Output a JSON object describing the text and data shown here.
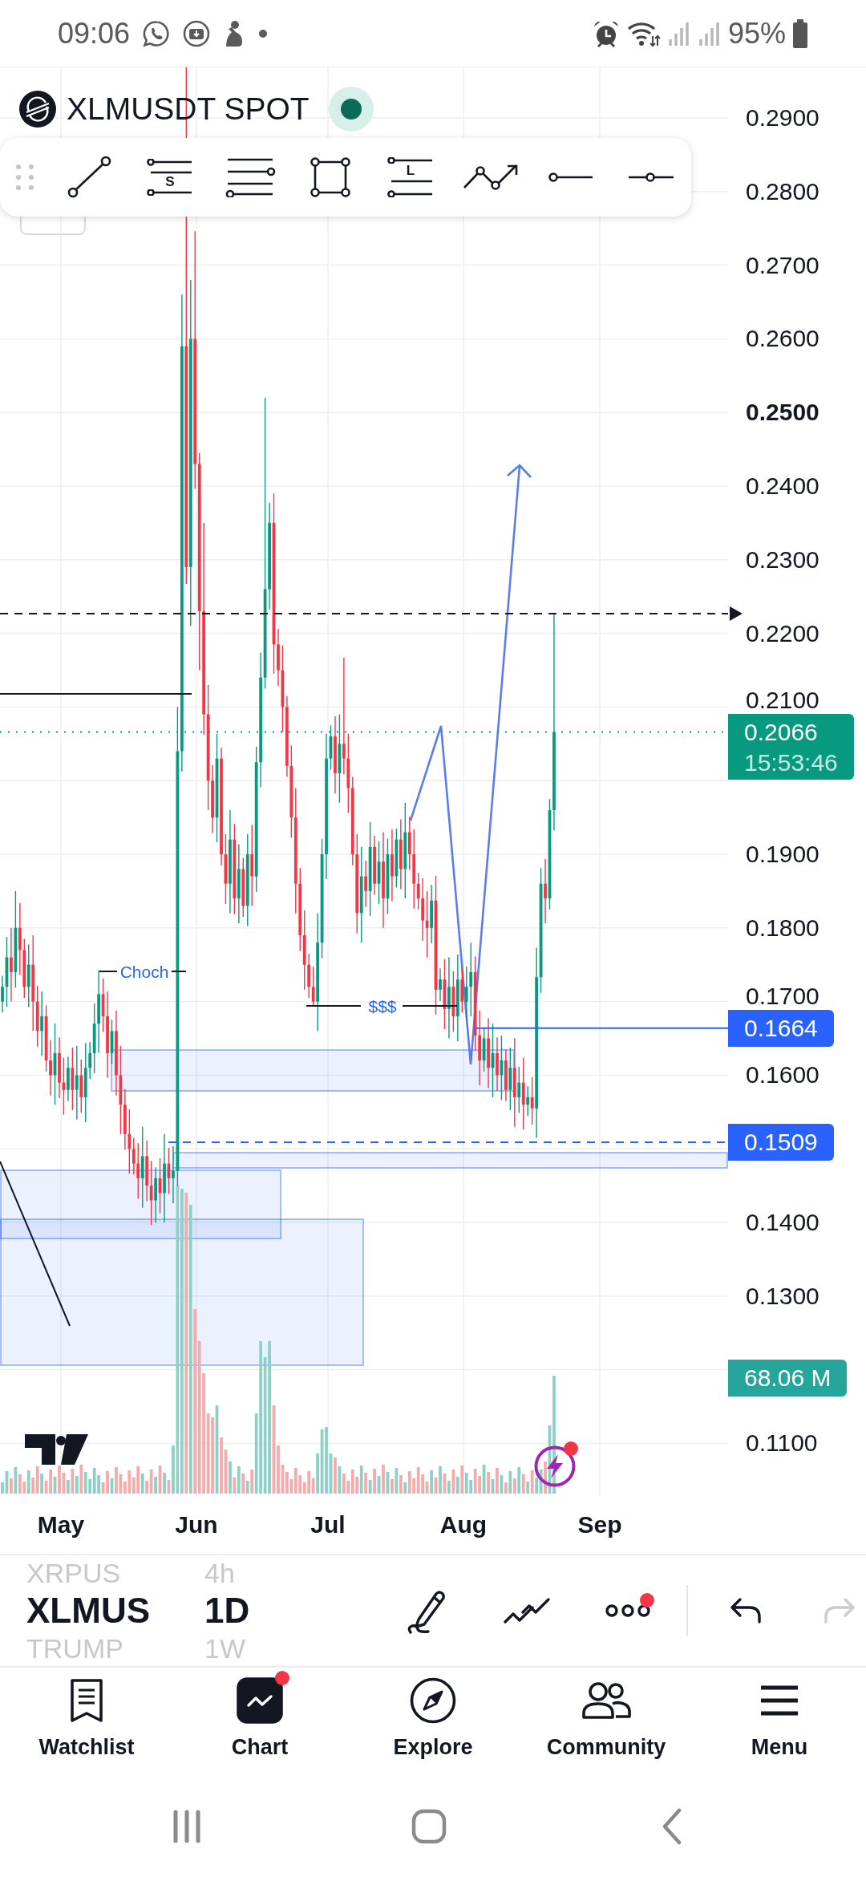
{
  "status_bar": {
    "time": "09:06",
    "battery": "95%"
  },
  "legend": {
    "symbol": "XLMUSDT SPOT",
    "market_open": true
  },
  "drawing_toolbar": {
    "tools": [
      {
        "kind": "trend_line"
      },
      {
        "kind": "short_position",
        "letter": "S"
      },
      {
        "kind": "parallel_lines"
      },
      {
        "kind": "rectangle"
      },
      {
        "kind": "long_position",
        "letter": "L"
      },
      {
        "kind": "path"
      },
      {
        "kind": "ray"
      },
      {
        "kind": "horizontal_line"
      }
    ]
  },
  "chart": {
    "price_axis": [
      {
        "label": "0.2900",
        "major": false
      },
      {
        "label": "0.2800",
        "major": false
      },
      {
        "label": "0.2700",
        "major": false
      },
      {
        "label": "0.2600",
        "major": false
      },
      {
        "label": "0.2500",
        "major": true
      },
      {
        "label": "0.2400",
        "major": false
      },
      {
        "label": "0.2300",
        "major": false
      },
      {
        "label": "0.2200",
        "major": false
      },
      {
        "label": "0.2100",
        "major": false
      },
      {
        "label": "0.1900",
        "major": false
      },
      {
        "label": "0.1800",
        "major": false
      },
      {
        "label": "0.1700",
        "major": false
      },
      {
        "label": "0.1600",
        "major": false
      },
      {
        "label": "0.1400",
        "major": false
      },
      {
        "label": "0.1300",
        "major": false
      },
      {
        "label": "0.1100",
        "major": false
      }
    ],
    "price_tags": [
      {
        "kind": "last_price",
        "value": "0.2066",
        "countdown": "15:53:46"
      },
      {
        "kind": "line",
        "value": "0.1664"
      },
      {
        "kind": "line",
        "value": "0.1509"
      },
      {
        "kind": "volume",
        "value": "68.06 M"
      }
    ],
    "annotations": [
      "Choch",
      "$$$"
    ],
    "time_axis": [
      "May",
      "Jun",
      "Jul",
      "Aug",
      "Sep"
    ]
  },
  "symbol_picker": [
    {
      "symbol": "XRPUS",
      "interval": "4h",
      "selected": false
    },
    {
      "symbol": "XLMUS",
      "interval": "1D",
      "selected": true
    },
    {
      "symbol": "TRUMP",
      "interval": "1W",
      "selected": false
    }
  ],
  "chart_tools": [
    {
      "kind": "draw",
      "badge": false,
      "disabled": false
    },
    {
      "kind": "drawings",
      "badge": false,
      "disabled": false
    },
    {
      "kind": "more",
      "badge": true,
      "disabled": false
    },
    {
      "kind": "undo",
      "badge": false,
      "disabled": false
    },
    {
      "kind": "redo",
      "badge": false,
      "disabled": true
    }
  ],
  "nav": [
    {
      "kind": "watchlist",
      "label": "Watchlist",
      "selected": false,
      "badge": false
    },
    {
      "kind": "chart",
      "label": "Chart",
      "selected": true,
      "badge": true
    },
    {
      "kind": "explore",
      "label": "Explore",
      "selected": false,
      "badge": false
    },
    {
      "kind": "community",
      "label": "Community",
      "selected": false,
      "badge": false
    },
    {
      "kind": "menu",
      "label": "Menu",
      "selected": false,
      "badge": false
    }
  ]
}
